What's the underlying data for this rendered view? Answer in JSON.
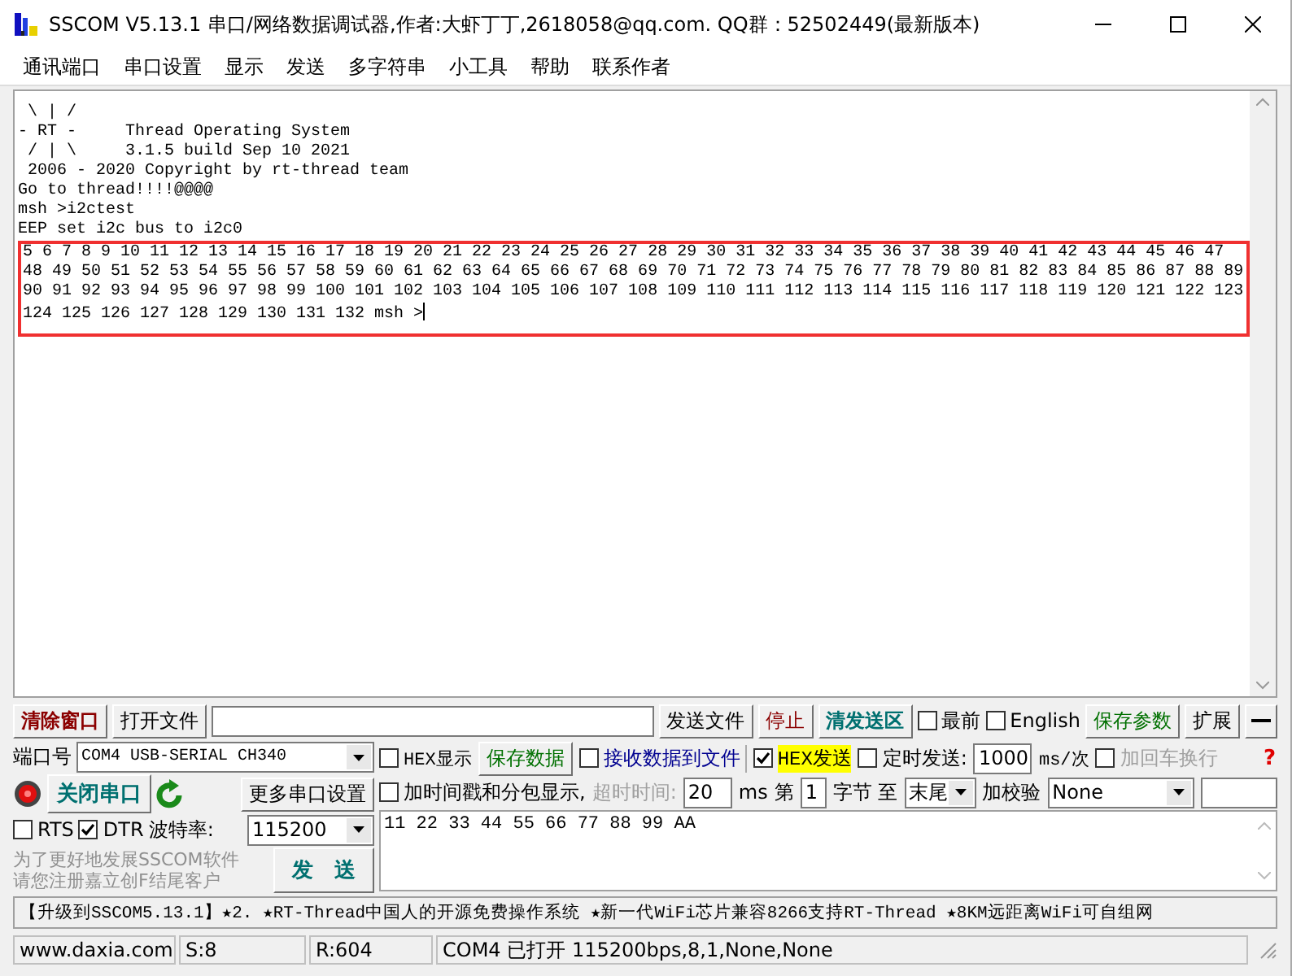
{
  "window": {
    "title": "SSCOM V5.13.1 串口/网络数据调试器,作者:大虾丁丁,2618058@qq.com. QQ群：52502449(最新版本)"
  },
  "menu": [
    "通讯端口",
    "串口设置",
    "显示",
    "发送",
    "多字符串",
    "小工具",
    "帮助",
    "联系作者"
  ],
  "terminal": {
    "lines": [
      " \\ | /",
      "- RT -     Thread Operating System",
      " / | \\     3.1.5 build Sep 10 2021",
      " 2006 - 2020 Copyright by rt-thread team",
      "Go to thread!!!!@@@@",
      "msh >i2ctest",
      "EEP set i2c bus to i2c0"
    ],
    "highlighted_lines": [
      "5 6 7 8 9 10 11 12 13 14 15 16 17 18 19 20 21 22 23 24 25 26 27 28 29 30 31 32 33 34 35 36 37 38 39 40 41 42 43 44 45 46 47",
      "48 49 50 51 52 53 54 55 56 57 58 59 60 61 62 63 64 65 66 67 68 69 70 71 72 73 74 75 76 77 78 79 80 81 82 83 84 85 86 87 88 89",
      "90 91 92 93 94 95 96 97 98 99 100 101 102 103 104 105 106 107 108 109 110 111 112 113 114 115 116 117 118 119 120 121 122 123",
      "124 125 126 127 128 129 130 131 132 msh >"
    ]
  },
  "toolbar": {
    "clear_window": "清除窗口",
    "open_file": "打开文件",
    "send_file": "发送文件",
    "stop": "停止",
    "clear_send": "清发送区",
    "topmost": {
      "label": "最前",
      "checked": false
    },
    "english": {
      "label": "English",
      "checked": false
    },
    "save_params": "保存参数",
    "expand": "扩展"
  },
  "port_panel": {
    "port_label": "端口号",
    "port_value": "COM4 USB-SERIAL CH340",
    "port_open": true,
    "open_button": "关闭串口",
    "more_settings": "更多串口设置",
    "rts": {
      "label": "RTS",
      "checked": false
    },
    "dtr": {
      "label": "DTR",
      "checked": true
    },
    "baud_label": "波特率:",
    "baud_value": "115200",
    "promo": [
      "为了更好地发展SSCOM软件",
      "请您注册嘉立创F结尾客户"
    ],
    "send_button": "发　送"
  },
  "options": {
    "hex_display": {
      "label": "HEX显示",
      "checked": false
    },
    "save_data": "保存数据",
    "receive_to_file": {
      "label": "接收数据到文件",
      "checked": false
    },
    "hex_send": {
      "label": "HEX发送",
      "checked": true
    },
    "timed_send": {
      "label": "定时发送:",
      "checked": false
    },
    "interval": "1000",
    "interval_unit": "ms/次",
    "add_crlf": {
      "label": "加回车换行",
      "checked": false,
      "disabled": true
    },
    "help": "?",
    "timestamp": {
      "label": "加时间戳和分包显示,",
      "checked": false
    },
    "timeout": {
      "label": "超时时间:",
      "value": "20",
      "unit": "ms",
      "disabled": true
    },
    "byte_from_label": "第",
    "byte_from": "1",
    "byte_to_label": "字节 至",
    "byte_to": "末尾",
    "checksum_label": "加校验",
    "checksum": "None"
  },
  "send_area": {
    "value": "11 22 33 44 55 66 77 88 99 AA"
  },
  "marquee": "【升级到SSCOM5.13.1】★2. ★RT-Thread中国人的开源免费操作系统 ★新一代WiFi芯片兼容8266支持RT-Thread ★8KM远距离WiFi可自组网",
  "status_bar": [
    "www.daxia.com",
    "S:8",
    "R:604",
    "COM4 已打开  115200bps,8,1,None,None"
  ]
}
